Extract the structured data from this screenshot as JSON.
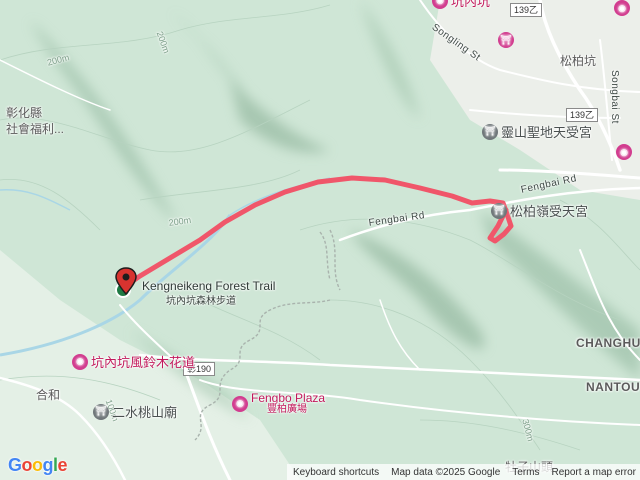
{
  "colors": {
    "route": "#f0566a",
    "marker": "#1f7a43",
    "poi_pink": "#d23c8f",
    "poi_gray": "#6f7679",
    "terrain_base": "#cfe6d6",
    "water": "#a9d6e6",
    "road": "#ffffff"
  },
  "top_cut_label": "坑內坑",
  "places": {
    "top_right_cut": "",
    "songbai_keng": "松柏坑",
    "changhua_social": {
      "line1": "彰化縣",
      "line2": "社會福利..."
    },
    "hehe": "合和",
    "changhu": "CHANGHU",
    "nantou": "NANTOU",
    "bottom_cut": "牡子山頭"
  },
  "pois": {
    "lingshan": {
      "label": "靈山聖地天受宮",
      "icon": "temple-icon"
    },
    "songbailing": {
      "label": "松柏嶺受天宮",
      "icon": "temple-icon"
    },
    "kengnei_flower": {
      "label": "坑內坑風鈴木花道",
      "icon": "camera-icon"
    },
    "ershui_temple": {
      "label": "二水桃山廟",
      "icon": "temple-icon"
    },
    "fengbo_plaza": {
      "label_en": "Fengbo Plaza",
      "label_cn": "豐柏廣場",
      "icon": "camera-icon"
    },
    "top_right_attraction": {
      "icon": "camera-icon"
    },
    "top_right_temple": {
      "icon": "temple-icon"
    },
    "top_cut_attraction": {
      "icon": "camera-icon"
    }
  },
  "roads": {
    "songling_st": "Songling St",
    "songbai_st": "Songbai St",
    "fengbai_rd_1": "Fengbai Rd",
    "fengbai_rd_2": "Fengbai Rd",
    "r139_top": "139乙",
    "r139_mid": "139乙",
    "r190": "彰190"
  },
  "contours": {
    "c1": "200m",
    "c2": "200m",
    "c3": "200m",
    "c4": "100m",
    "c5": "300m"
  },
  "trail": {
    "label_en": "Kengneikeng Forest Trail",
    "label_cn": "坑內坑森林步道"
  },
  "attribution": {
    "logo": "Google",
    "shortcuts": "Keyboard shortcuts",
    "data": "Map data ©2025 Google",
    "terms": "Terms",
    "report": "Report a map error"
  }
}
